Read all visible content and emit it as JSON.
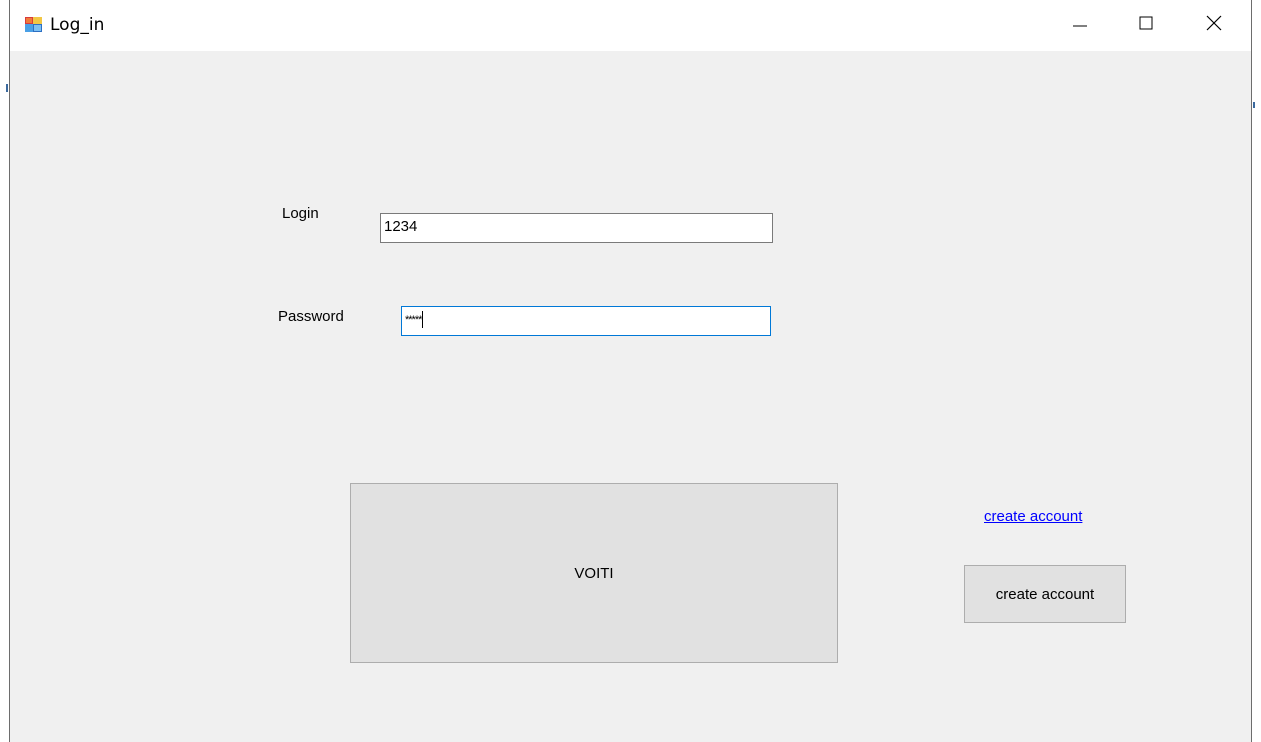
{
  "window": {
    "title": "Log_in"
  },
  "title_bar": {
    "minimize_icon": "minimize-icon",
    "maximize_icon": "maximize-icon",
    "close_icon": "close-icon"
  },
  "form": {
    "login_label": "Login",
    "login_value": "1234",
    "password_label": "Password",
    "password_value": "*****",
    "submit_label": "VOITI",
    "create_account_link": "create account",
    "create_account_button": "create account"
  },
  "colors": {
    "form_background": "#f0f0f0",
    "focus_border": "#0078d7",
    "link": "#0000ff"
  }
}
